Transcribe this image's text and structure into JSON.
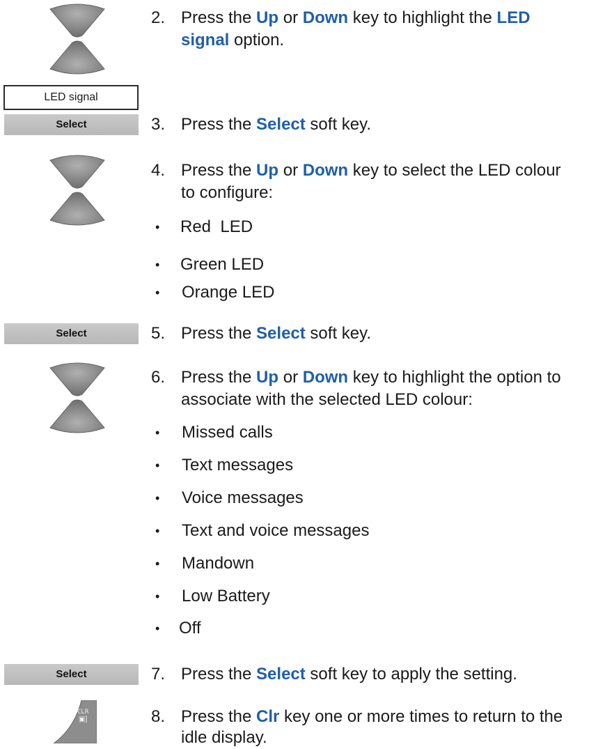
{
  "display": {
    "label": "LED signal"
  },
  "softkeys": {
    "select_label": "Select"
  },
  "clr_key": {
    "line1": "CLR",
    "line2": "▣]"
  },
  "steps": [
    {
      "num": "2.",
      "parts": [
        "Press the ",
        "Up",
        " or ",
        "Down",
        " key to highlight the ",
        "LED",
        "signal",
        " option."
      ]
    },
    {
      "num": "3.",
      "parts": [
        "Press the ",
        "Select",
        " soft key."
      ]
    },
    {
      "num": "4.",
      "parts": [
        "Press the ",
        "Up",
        " or ",
        "Down",
        " key to select the LED colour",
        "to configure:"
      ]
    },
    {
      "num": "5.",
      "parts": [
        "Press the ",
        "Select",
        " soft key."
      ]
    },
    {
      "num": "6.",
      "parts": [
        "Press the ",
        "Up",
        " or ",
        "Down",
        " key to highlight the option to",
        "associate with the selected LED colour:"
      ]
    },
    {
      "num": "7.",
      "parts": [
        "Press the ",
        "Select",
        " soft key to apply the setting."
      ]
    },
    {
      "num": "8.",
      "parts": [
        "Press the ",
        "Clr",
        " key one or more times to return to the",
        "idle display."
      ]
    }
  ],
  "led_colours": [
    "Red  LED",
    "Green LED",
    "Orange LED"
  ],
  "options": [
    "Missed calls",
    "Text messages",
    "Voice messages",
    "Text and voice messages",
    "Mandown",
    "Low Battery",
    "Off"
  ],
  "bullet": "•",
  "icons": [
    "nav-up-key-icon",
    "nav-down-key-icon",
    "clr-key-icon"
  ],
  "colors": {
    "keyword": "#1f5fa8",
    "softkey_bg": "#c0c0c0",
    "nav_key": "#8a8a8a"
  }
}
